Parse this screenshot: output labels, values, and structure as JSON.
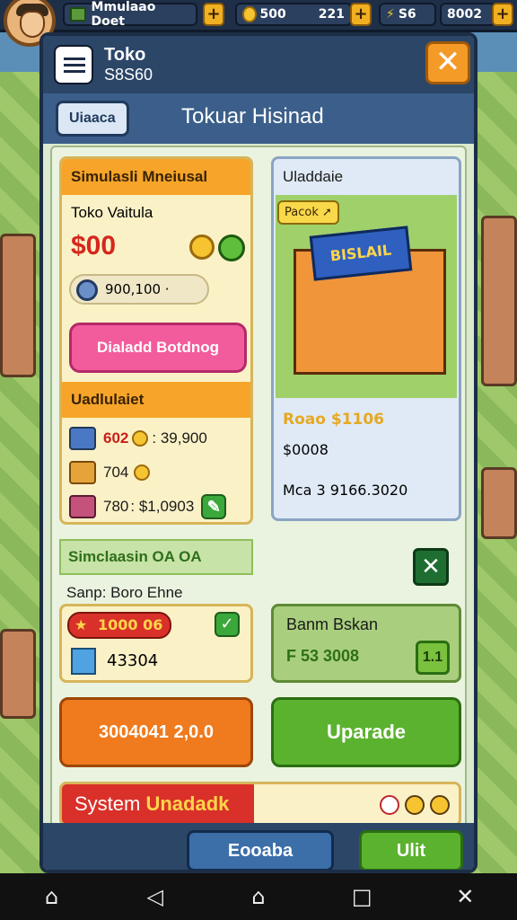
{
  "hud": {
    "currency_label": "Mmulaao Doet",
    "coins": "500",
    "gems": "221",
    "stars_label": "S6",
    "cash": "8002"
  },
  "modal": {
    "title": "Toko",
    "subtitle_value": "S8S60",
    "tab_label": "Uiaaca",
    "header_title": "Tokuar Hisinad",
    "close": "✕"
  },
  "left_card": {
    "heading": "Simulasli Mneiusal",
    "store_label": "Toko Vaitula",
    "price": "$00",
    "input_value": "900,100 ·",
    "pink_button": "Dialadd Botdnog"
  },
  "upgrades": {
    "heading": "Uadlulaiet",
    "rows": [
      {
        "a": "602",
        "b": ": 39,900"
      },
      {
        "a": "704",
        "b": ""
      },
      {
        "a": "780",
        "b": ": $1,0903"
      }
    ]
  },
  "right_card": {
    "heading": "Uladdaie",
    "badge": "Pacok",
    "sign": "BISLAIL",
    "line1": "Roao $1106",
    "line2": "$0008",
    "line3": "Mca 3 9166.3020"
  },
  "simulation": {
    "heading": "Simclaasin OA OA",
    "sale_line": "Sanp: Boro Ehne",
    "red_pill": "1000 06",
    "box_value": "43304",
    "right_title": "Banm Bskan",
    "right_value": "F 53 3008",
    "right_icon": "1.1"
  },
  "buttons": {
    "orange": "3004041 2,0.0",
    "green": "Uparade"
  },
  "system_bar": {
    "prefix": "System",
    "suffix": "Unadadk"
  },
  "footer": {
    "blue": "Eooaba",
    "green": "Ulit"
  },
  "colors": {
    "accent_orange": "#f49a27",
    "accent_green": "#5bb22f",
    "header_blue": "#2c4668"
  }
}
